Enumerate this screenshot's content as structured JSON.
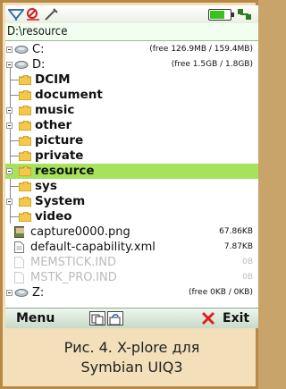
{
  "status": {
    "icons": [
      "signal-icon",
      "offline-icon",
      "pen-icon"
    ],
    "battery_level": 0.7
  },
  "path": "D:\\resource",
  "items": [
    {
      "name": "C:",
      "info": "(free 126.9MB / 159.4MB)",
      "type": "drive"
    },
    {
      "name": "D:",
      "info": "(free 1.5GB / 1.8GB)",
      "type": "drive"
    },
    {
      "name": "DCIM",
      "type": "folder"
    },
    {
      "name": "document",
      "type": "folder"
    },
    {
      "name": "music",
      "type": "folder"
    },
    {
      "name": "other",
      "type": "folder"
    },
    {
      "name": "picture",
      "type": "folder"
    },
    {
      "name": "private",
      "type": "folder"
    },
    {
      "name": "resource",
      "type": "folder",
      "selected": true
    },
    {
      "name": "sys",
      "type": "folder"
    },
    {
      "name": "System",
      "type": "folder"
    },
    {
      "name": "video",
      "type": "folder"
    },
    {
      "name": "capture0000.png",
      "info": "67.86KB",
      "type": "file"
    },
    {
      "name": "default-capability.xml",
      "info": "7.87KB",
      "type": "file"
    },
    {
      "name": "MEMSTICK.IND",
      "info": "0B",
      "type": "file"
    },
    {
      "name": "MSTK_PRO.IND",
      "info": "0B",
      "type": "file"
    },
    {
      "name": "Z:",
      "info": "(free 0KB / 0KB)",
      "type": "drive"
    }
  ],
  "softkeys": {
    "left": "Menu",
    "right": "Exit"
  },
  "caption": {
    "line1": "Рис. 4. X-plore для",
    "line2": "Symbian UIQ3"
  },
  "colors": {
    "selection": "#a6e25c",
    "folder": "#f6c84a",
    "frame": "#b88a48"
  }
}
